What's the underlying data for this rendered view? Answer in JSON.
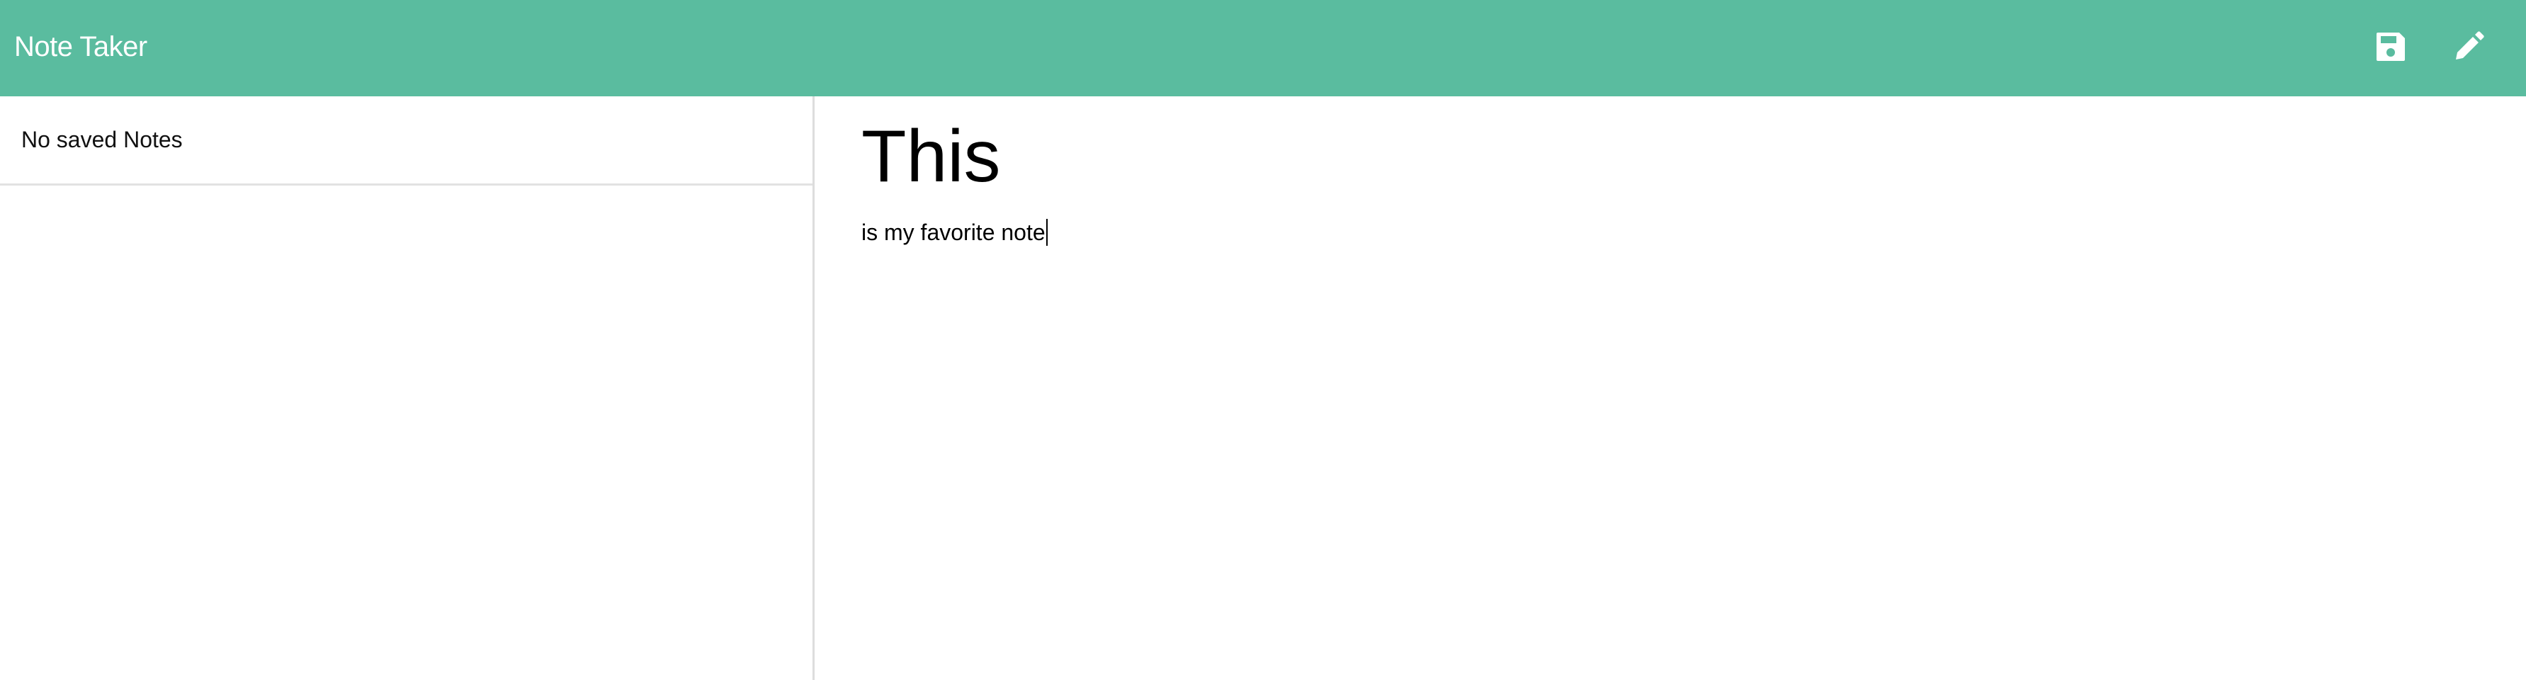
{
  "navbar": {
    "brand": "Note Taker",
    "background": "#5abc9f",
    "icons": {
      "save": "save-icon",
      "new": "pencil-icon"
    }
  },
  "sidebar": {
    "empty_message": "No saved Notes"
  },
  "editor": {
    "title": "This",
    "body": "is my favorite note"
  }
}
